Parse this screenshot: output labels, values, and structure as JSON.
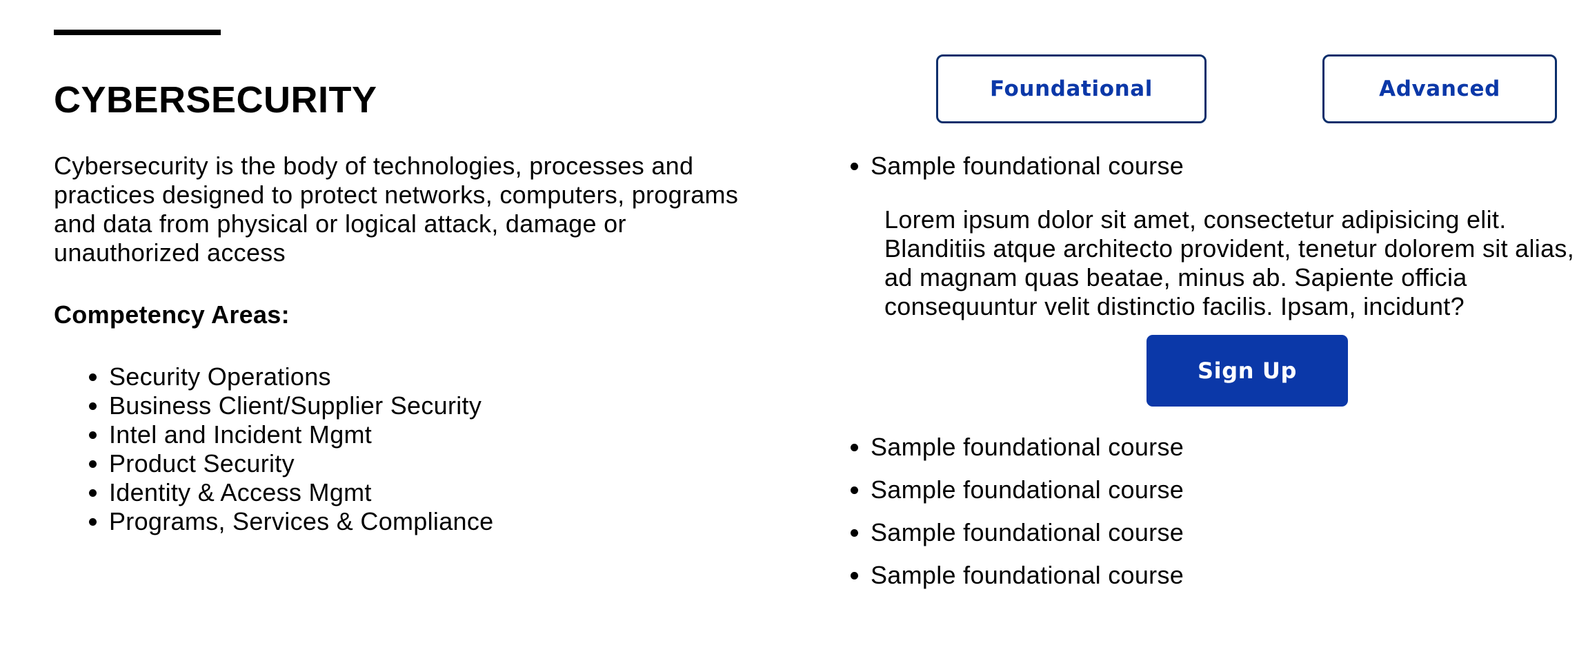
{
  "page": {
    "title": "CYBERSECURITY",
    "description": "Cybersecurity is the body of technologies, processes and practices designed to protect networks, computers, programs and data from physical or logical attack, damage or unauthorized access",
    "competency_heading": "Competency Areas:",
    "competency_areas": [
      "Security Operations",
      "Business Client/Supplier Security",
      "Intel and Incident Mgmt",
      "Product Security",
      "Identity & Access Mgmt",
      "Programs, Services & Compliance"
    ]
  },
  "tabs": {
    "foundational_label": "Foundational",
    "advanced_label": "Advanced"
  },
  "courses": {
    "expanded": {
      "title": "Sample foundational course",
      "description": "Lorem ipsum dolor sit amet, consectetur adipisicing elit. Blanditiis atque architecto provident, tenetur dolorem sit alias, ad magnam quas beatae, minus ab. Sapiente officia consequuntur velit distinctio facilis. Ipsam, incidunt?",
      "signup_label": "Sign Up"
    },
    "list": [
      "Sample foundational course",
      "Sample foundational course",
      "Sample foundational course",
      "Sample foundational course"
    ]
  },
  "colors": {
    "accent": "#0b38a8",
    "border": "#0b2e6b",
    "text": "#000000",
    "background": "#ffffff"
  }
}
